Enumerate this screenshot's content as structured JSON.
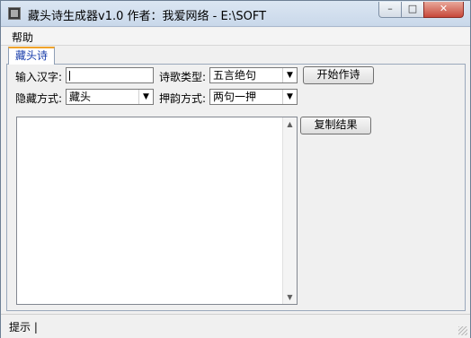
{
  "window": {
    "title": "藏头诗生成器v1.0  作者：我爱网络 - E:\\SOFT",
    "controls": {
      "minimize": "–",
      "maximize": "□",
      "close": "✕"
    }
  },
  "menu": {
    "help": "帮助"
  },
  "tabs": [
    {
      "label": "藏头诗",
      "active": true
    }
  ],
  "form": {
    "input_label": "输入汉字:",
    "input_value": "",
    "poem_type_label": "诗歌类型:",
    "poem_type_value": "五言绝句",
    "hide_mode_label": "隐藏方式:",
    "hide_mode_value": "藏头",
    "rhyme_label": "押韵方式:",
    "rhyme_value": "两句一押"
  },
  "buttons": {
    "start": "开始作诗",
    "copy": "复制结果"
  },
  "result": {
    "text": ""
  },
  "statusbar": {
    "text": "提示 |"
  },
  "icons": {
    "dropdown": "chevron-down-icon",
    "scroll_up": "scroll-up-icon",
    "scroll_down": "scroll-down-icon"
  },
  "colors": {
    "accent": "#f0a32a",
    "tab_text": "#1a3eab",
    "close": "#c7483a"
  }
}
